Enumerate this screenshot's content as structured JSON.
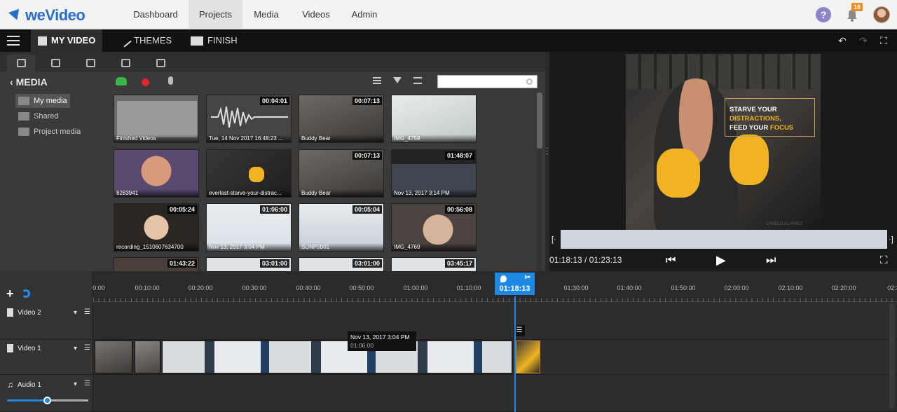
{
  "app": {
    "logo": "weVideo",
    "nav": [
      "Dashboard",
      "Projects",
      "Media",
      "Videos",
      "Admin"
    ],
    "active_nav": "Projects",
    "notifications": "16"
  },
  "toolbar": {
    "my_video": "MY VIDEO",
    "themes": "THEMES",
    "finish": "FINISH"
  },
  "media": {
    "title": "MEDIA",
    "search_placeholder": "",
    "folders": [
      "My media",
      "Shared",
      "Project media"
    ],
    "items": [
      {
        "label": "Finished Videos",
        "duration": ""
      },
      {
        "label": "Tue, 14 Nov 2017 16:48:23 ...",
        "duration": "00:04:01"
      },
      {
        "label": "Buddy Bear",
        "duration": "00:07:13"
      },
      {
        "label": "IMG_4759",
        "duration": ""
      },
      {
        "label": "8283941",
        "duration": ""
      },
      {
        "label": "everlast-starve-your-distrac...",
        "duration": ""
      },
      {
        "label": "Buddy Bear",
        "duration": "00:07:13"
      },
      {
        "label": "Nov 13, 2017 3:14 PM",
        "duration": "01:48:07"
      },
      {
        "label": "recording_1510607634700",
        "duration": "00:05:24"
      },
      {
        "label": "Nov 13, 2017 3:04 PM",
        "duration": "01:06:00"
      },
      {
        "label": "SUNP0001",
        "duration": "00:05:04"
      },
      {
        "label": "IMG_4769",
        "duration": "00:56:08"
      },
      {
        "label": "",
        "duration": "01:43:22"
      },
      {
        "label": "",
        "duration": "03:01:00"
      },
      {
        "label": "",
        "duration": "03:01:00"
      },
      {
        "label": "",
        "duration": "03:45:17"
      }
    ]
  },
  "preview": {
    "caption_line1_a": "STARVE YOUR ",
    "caption_line1_b": "DISTRACTIONS,",
    "caption_line2_a": "FEED YOUR ",
    "caption_line2_b": "FOCUS",
    "signature": "CANELO ALVAREZ",
    "timecode": "01:18:13 / 01:23:13"
  },
  "timeline": {
    "ruler": [
      "0:00",
      "00:10:00",
      "00:20:00",
      "00:30:00",
      "00:40:00",
      "00:50:00",
      "01:00:00",
      "01:10:00",
      "01:30:00",
      "01:40:00",
      "01:50:00",
      "02:00:00",
      "02:10:00",
      "02:20:00",
      "02:3"
    ],
    "playhead": "01:18:13",
    "tracks": [
      "Video 2",
      "Video 1",
      "Audio 1"
    ],
    "tooltip_title": "Nov 13, 2017 3:04 PM",
    "tooltip_duration": "01:06:00",
    "volume": 0.5
  },
  "colors": {
    "brand": "#2a6ec7",
    "playhead": "#1e88e5",
    "caption_highlight": "#f0b423",
    "record": "#e3262b",
    "upload": "#3cb54a",
    "badge": "#f08c1b"
  }
}
